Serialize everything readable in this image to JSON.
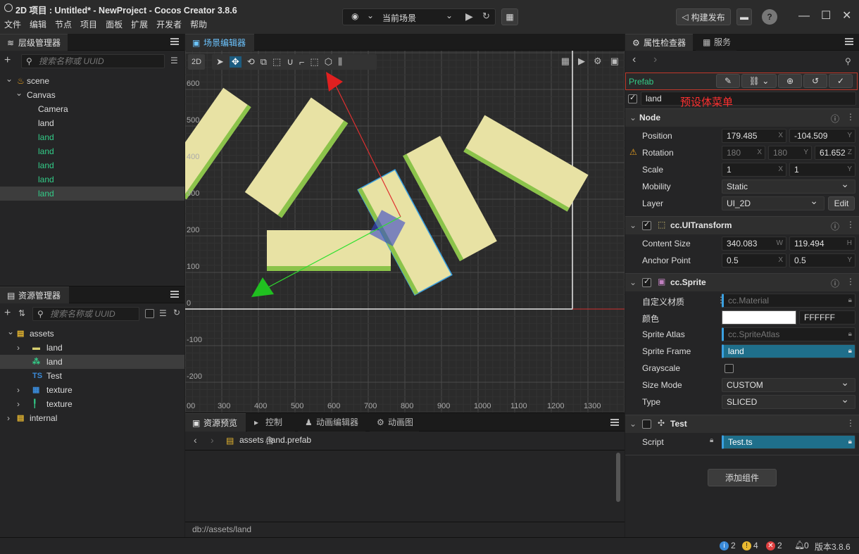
{
  "titlebar": {
    "title": "2D 项目 : Untitled* - NewProject - Cocos Creator 3.8.6",
    "menu": [
      "文件",
      "编辑",
      "节点",
      "项目",
      "面板",
      "扩展",
      "开发者",
      "帮助"
    ],
    "scene_select": "当前场景",
    "build_button": "构建发布"
  },
  "hierarchy": {
    "tab": "层级管理器",
    "search_placeholder": "搜索名称或 UUID",
    "nodes": [
      {
        "label": "scene",
        "depth": 0
      },
      {
        "label": "Canvas",
        "depth": 1
      },
      {
        "label": "Camera",
        "depth": 2
      },
      {
        "label": "land",
        "depth": 2
      },
      {
        "label": "land",
        "depth": 2,
        "prefab": true
      },
      {
        "label": "land",
        "depth": 2,
        "prefab": true
      },
      {
        "label": "land",
        "depth": 2,
        "prefab": true
      },
      {
        "label": "land",
        "depth": 2,
        "prefab": true
      },
      {
        "label": "land",
        "depth": 2,
        "prefab": true,
        "selected": true
      }
    ]
  },
  "assets": {
    "tab": "资源管理器",
    "search_placeholder": "搜索名称或 UUID",
    "items": [
      {
        "label": "assets",
        "depth": 0
      },
      {
        "label": "land",
        "depth": 1
      },
      {
        "label": "land",
        "depth": 1,
        "selected": true
      },
      {
        "label": "Test",
        "depth": 1
      },
      {
        "label": "texture",
        "depth": 1
      },
      {
        "label": "texture",
        "depth": 1
      },
      {
        "label": "internal",
        "depth": 0
      }
    ]
  },
  "scene_editor": {
    "tab": "场景编辑器",
    "mode": "2D",
    "y_ticks": [
      "600",
      "500",
      "400",
      "300",
      "200",
      "100",
      "0",
      "-100",
      "-200"
    ],
    "x_ticks": [
      "00",
      "300",
      "400",
      "500",
      "600",
      "700",
      "800",
      "900",
      "1000",
      "1100",
      "1200",
      "1300"
    ]
  },
  "bottom": {
    "tabs": [
      "资源预览",
      "控制台",
      "动画编辑器",
      "动画图"
    ],
    "path_root": "assets",
    "path_file": "land.prefab",
    "footer_path": "db://assets/land"
  },
  "inspector": {
    "tabs": [
      "属性检查器",
      "服务"
    ],
    "prefab_label": "Prefab",
    "node_name": "land",
    "annotation": "预设体菜单",
    "node": {
      "title": "Node",
      "position_label": "Position",
      "position": [
        "179.485",
        "-104.509"
      ],
      "rotation_label": "Rotation",
      "rotation": [
        "180",
        "180",
        "61.652"
      ],
      "scale_label": "Scale",
      "scale": [
        "1",
        "1"
      ],
      "mobility_label": "Mobility",
      "mobility": "Static",
      "layer_label": "Layer",
      "layer": "UI_2D",
      "edit_label": "Edit"
    },
    "uitransform": {
      "title": "cc.UITransform",
      "content_size_label": "Content Size",
      "content_size": [
        "340.083",
        "119.494"
      ],
      "anchor_label": "Anchor Point",
      "anchor": [
        "0.5",
        "0.5"
      ]
    },
    "sprite": {
      "title": "cc.Sprite",
      "material_label": "自定义材质",
      "material": "cc.Material",
      "color_label": "颜色",
      "color_hex": "FFFFFF",
      "atlas_label": "Sprite Atlas",
      "atlas": "cc.SpriteAtlas",
      "frame_label": "Sprite Frame",
      "frame": "land",
      "grayscale_label": "Grayscale",
      "sizemode_label": "Size Mode",
      "sizemode": "CUSTOM",
      "type_label": "Type",
      "type": "SLICED"
    },
    "test": {
      "title": "Test",
      "script_label": "Script",
      "script": "Test.ts"
    },
    "add_component": "添加组件"
  },
  "status": {
    "info": "2",
    "warn": "4",
    "error": "2",
    "bell": "0",
    "version": "版本3.8.6"
  },
  "colors": {
    "accent": "#3aa0e0",
    "prefab_green": "#33cc88",
    "red_box": "#c0392b",
    "land_fill": "#e8e2a4",
    "land_stripe": "#8bc34a"
  }
}
